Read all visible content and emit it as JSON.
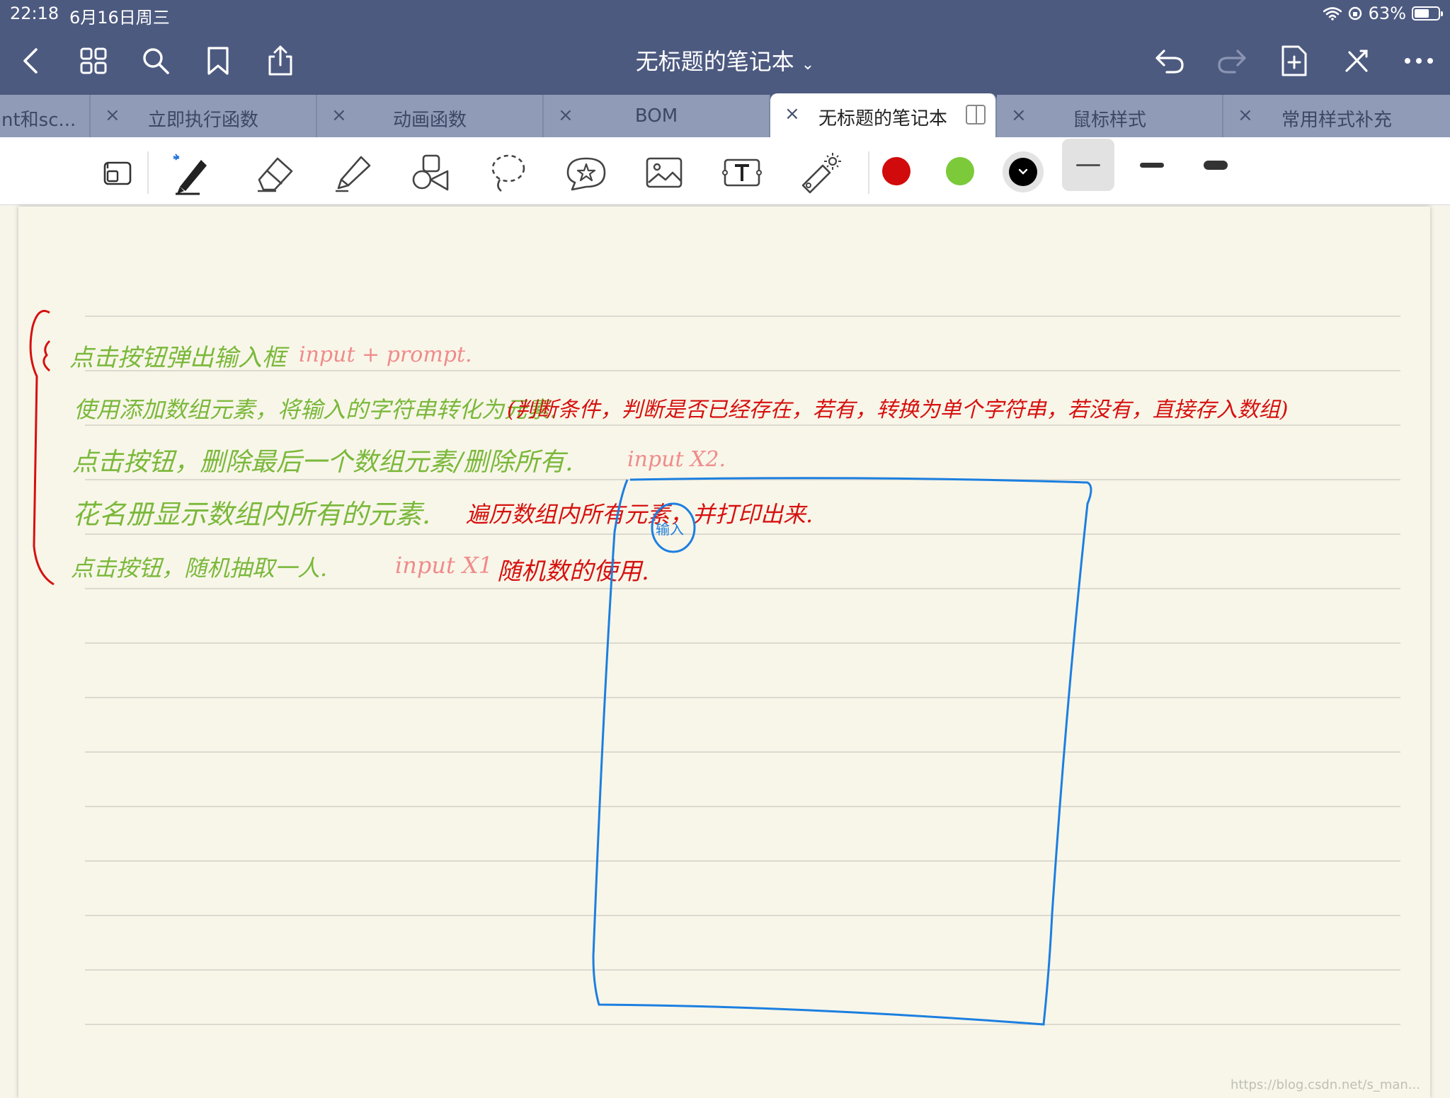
{
  "status_bar": {
    "time": "22:18",
    "date": "6月16日周三",
    "battery": "63%",
    "battery_level": 0.63
  },
  "nav": {
    "title": "无标题的笔记本",
    "icons": [
      "back-icon",
      "grid-icon",
      "search-icon",
      "bookmark-icon",
      "share-icon",
      "undo-icon",
      "redo-icon",
      "new-page-icon",
      "close-tools-icon",
      "more-icon"
    ]
  },
  "tabs": [
    {
      "label": "nt和sc..."
    },
    {
      "label": "立即执行函数",
      "close": "×"
    },
    {
      "label": "动画函数",
      "close": "×"
    },
    {
      "label": "BOM",
      "close": "×"
    },
    {
      "label": "无标题的笔记本",
      "close": "×",
      "active": true
    },
    {
      "label": "鼠标样式",
      "close": "×"
    },
    {
      "label": "常用样式补充",
      "close": "×"
    }
  ],
  "toolbar": {
    "tools": [
      "page-layout-icon",
      "pen-icon",
      "eraser-icon",
      "highlighter-icon",
      "shapes-icon",
      "lasso-icon",
      "sticker-icon",
      "image-icon",
      "text-icon",
      "laser-pointer-icon"
    ],
    "colors": [
      "#d10b0b",
      "#7cc93a",
      "#000000"
    ],
    "selected_color": "#000000"
  },
  "notes": {
    "line1_a": "点击按钮弹出输入框",
    "line1_b": "input + prompt.",
    "line2_a": "使用添加数组元素，将输入的字符串转化为元素.",
    "line2_b": "(判断条件，判断是否已经存在，若有，转换为单个字符串，若没有，直接存入数组)",
    "line3_a": "点击按钮，删除最后一个数组元素/删除所有.",
    "line3_b": "input X2.",
    "line4_a": "花名册显示数组内所有的元素.",
    "line4_b": "遍历数组内所有元素，并打印出来.",
    "line5_a": "点击按钮，随机抽取一人.",
    "line5_b": "input X1",
    "line5_c": "随机数的使用.",
    "sketch_label": "输入"
  },
  "watermark": "https://blog.csdn.net/s_man..."
}
